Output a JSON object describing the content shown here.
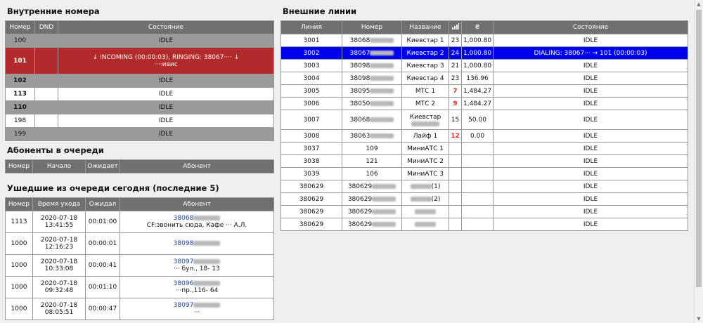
{
  "internal": {
    "title": "Внутренние номера",
    "headers": [
      "Номер",
      "DND",
      "Состояние"
    ],
    "rows": [
      {
        "num": "100",
        "state": "IDLE",
        "style": "gray",
        "bold": false
      },
      {
        "num": "101",
        "state": "↓ INCOMING (00:00:03), RINGING: 38067···· ↓",
        "state2": "····ивис",
        "style": "red",
        "bold": true
      },
      {
        "num": "102",
        "state": "IDLE",
        "style": "gray",
        "bold": true
      },
      {
        "num": "113",
        "state": "IDLE",
        "style": "white",
        "bold": true
      },
      {
        "num": "110",
        "state": "IDLE",
        "style": "gray",
        "bold": true
      },
      {
        "num": "198",
        "state": "IDLE",
        "style": "white",
        "bold": false
      },
      {
        "num": "199",
        "state": "IDLE",
        "style": "gray",
        "bold": false
      }
    ]
  },
  "queue": {
    "title": "Абоненты в очереди",
    "headers": [
      "Номер",
      "Начало",
      "Ожидает",
      "Абонент"
    ]
  },
  "left_queue": {
    "title": "Ушедшие из очереди сегодня (последние 5)",
    "headers": [
      "Номер",
      "Время ухода",
      "Ожидал",
      "Абонент"
    ],
    "rows": [
      {
        "num": "1113",
        "date": "2020-07-18",
        "time": "13:41:55",
        "wait": "00:01:00",
        "phone": "38068",
        "note": "CF:звонить сюда, Кафе ··· А.Л."
      },
      {
        "num": "1000",
        "date": "2020-07-18",
        "time": "12:16:23",
        "wait": "00:00:01",
        "phone": "38098",
        "note": ""
      },
      {
        "num": "1000",
        "date": "2020-07-18",
        "time": "10:33:08",
        "wait": "00:00:41",
        "phone": "38097",
        "note": "··· бул., 18- 13"
      },
      {
        "num": "1000",
        "date": "2020-07-18",
        "time": "09:32:48",
        "wait": "00:01:10",
        "phone": "38096",
        "note": "···пр.,116- 64"
      },
      {
        "num": "1000",
        "date": "2020-07-18",
        "time": "08:05:51",
        "wait": "00:00:47",
        "phone": "38097",
        "note": "···"
      }
    ]
  },
  "external": {
    "title": "Внешние линии",
    "headers": [
      "Линия",
      "Номер",
      "Название",
      "signal-icon",
      "currency-icon",
      "Состояние"
    ],
    "rows": [
      {
        "line": "3001",
        "num": "38068",
        "name": "Киевстар 1",
        "sig": "23",
        "bal": "1,000.80",
        "state": "IDLE",
        "style": "white",
        "sigred": false
      },
      {
        "line": "3002",
        "num": "38067",
        "name": "Киевстар 2",
        "sig": "24",
        "bal": "1,000.80",
        "state": "DIALING: 38067··· → 101 (00:00:03)",
        "style": "blue",
        "sigred": false
      },
      {
        "line": "3003",
        "num": "38098",
        "name": "Киевстар 3",
        "sig": "21",
        "bal": "1,000.80",
        "state": "IDLE",
        "style": "white",
        "sigred": false
      },
      {
        "line": "3004",
        "num": "38098",
        "name": "Киевстар 4",
        "sig": "23",
        "bal": "136.96",
        "state": "IDLE",
        "style": "white",
        "sigred": false
      },
      {
        "line": "3005",
        "num": "38095",
        "name": "МТС 1",
        "sig": "7",
        "bal": "1,484.27",
        "state": "IDLE",
        "style": "white",
        "sigred": true
      },
      {
        "line": "3006",
        "num": "38050",
        "name": "МТС 2",
        "sig": "9",
        "bal": "1,484.27",
        "state": "IDLE",
        "style": "white",
        "sigred": true
      },
      {
        "line": "3007",
        "num": "38068",
        "name": "Киевстар",
        "sig": "15",
        "bal": "50.00",
        "state": "IDLE",
        "style": "white",
        "sigred": false,
        "tall": true
      },
      {
        "line": "3008",
        "num": "38063",
        "name": "Лайф 1",
        "sig": "12",
        "bal": "0.00",
        "state": "IDLE",
        "style": "white",
        "sigred": true
      },
      {
        "line": "3037",
        "num": "109",
        "name": "МиниАТС 1",
        "sig": "",
        "bal": "",
        "state": "IDLE",
        "style": "white",
        "sigred": false
      },
      {
        "line": "3038",
        "num": "121",
        "name": "МиниАТС 2",
        "sig": "",
        "bal": "",
        "state": "IDLE",
        "style": "white",
        "sigred": false
      },
      {
        "line": "3039",
        "num": "106",
        "name": "МиниАТС 3",
        "sig": "",
        "bal": "",
        "state": "IDLE",
        "style": "white",
        "sigred": false
      },
      {
        "line": "380629",
        "num": "380629",
        "name": "(1)",
        "sig": "",
        "bal": "",
        "state": "IDLE",
        "style": "white",
        "sigred": false
      },
      {
        "line": "380629",
        "num": "380629",
        "name": "(2)",
        "sig": "",
        "bal": "",
        "state": "IDLE",
        "style": "white",
        "sigred": false
      },
      {
        "line": "380629",
        "num": "380629",
        "name": "",
        "sig": "",
        "bal": "",
        "state": "IDLE",
        "style": "white",
        "sigred": false
      },
      {
        "line": "380629",
        "num": "380629",
        "name": "",
        "sig": "",
        "bal": "",
        "state": "IDLE",
        "style": "white",
        "sigred": false
      }
    ]
  }
}
